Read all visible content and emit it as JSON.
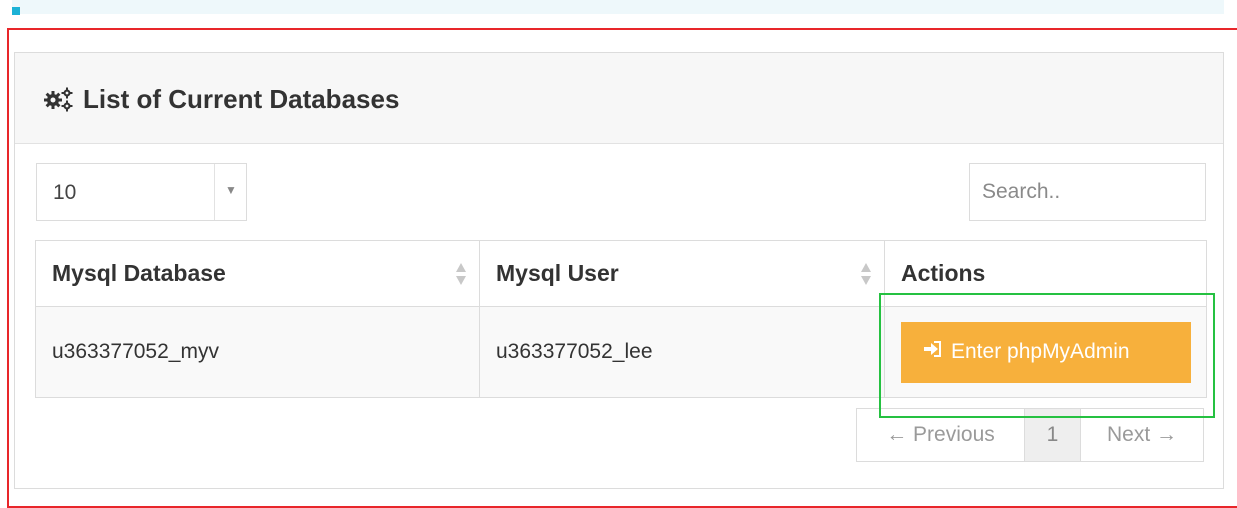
{
  "panel": {
    "title": "List of Current Databases",
    "title_icon": "gears-icon"
  },
  "controls": {
    "page_length": "10",
    "search_placeholder": "Search.."
  },
  "table": {
    "headers": [
      "Mysql Database",
      "Mysql User",
      "Actions"
    ],
    "rows": [
      {
        "database": "u363377052_myv",
        "user": "u363377052_lee",
        "action_label": "Enter phpMyAdmin",
        "action_icon": "sign-in-icon"
      }
    ]
  },
  "pagination": {
    "previous_label": "← Previous",
    "current_page": "1",
    "next_label": "Next →"
  },
  "colors": {
    "accent_button": "#f7b03c",
    "highlight_red": "#e8262a",
    "highlight_green": "#25c141",
    "top_accent": "#1cb2d6"
  }
}
